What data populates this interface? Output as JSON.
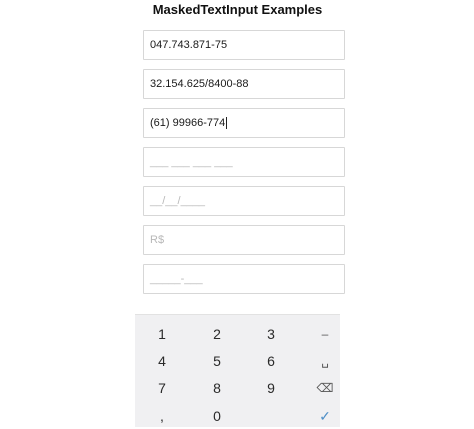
{
  "title": "MaskedTextInput Examples",
  "fields": [
    {
      "value": "047.743.871-75",
      "placeholder": ""
    },
    {
      "value": "32.154.625/8400-88",
      "placeholder": ""
    },
    {
      "value": "(61) 99966-774",
      "placeholder": ""
    },
    {
      "value": "",
      "placeholder": "___ ___ ___ ___"
    },
    {
      "value": "",
      "placeholder": "__/__/____"
    },
    {
      "value": "",
      "placeholder": "R$"
    },
    {
      "value": "",
      "placeholder": "_____-___"
    }
  ],
  "keyboard": {
    "row1": [
      "1",
      "2",
      "3",
      "–"
    ],
    "row2": [
      "4",
      "5",
      "6",
      "␣"
    ],
    "row3": [
      "7",
      "8",
      "9",
      "⌫"
    ],
    "row4": [
      ",",
      "0",
      "",
      "✓"
    ]
  }
}
